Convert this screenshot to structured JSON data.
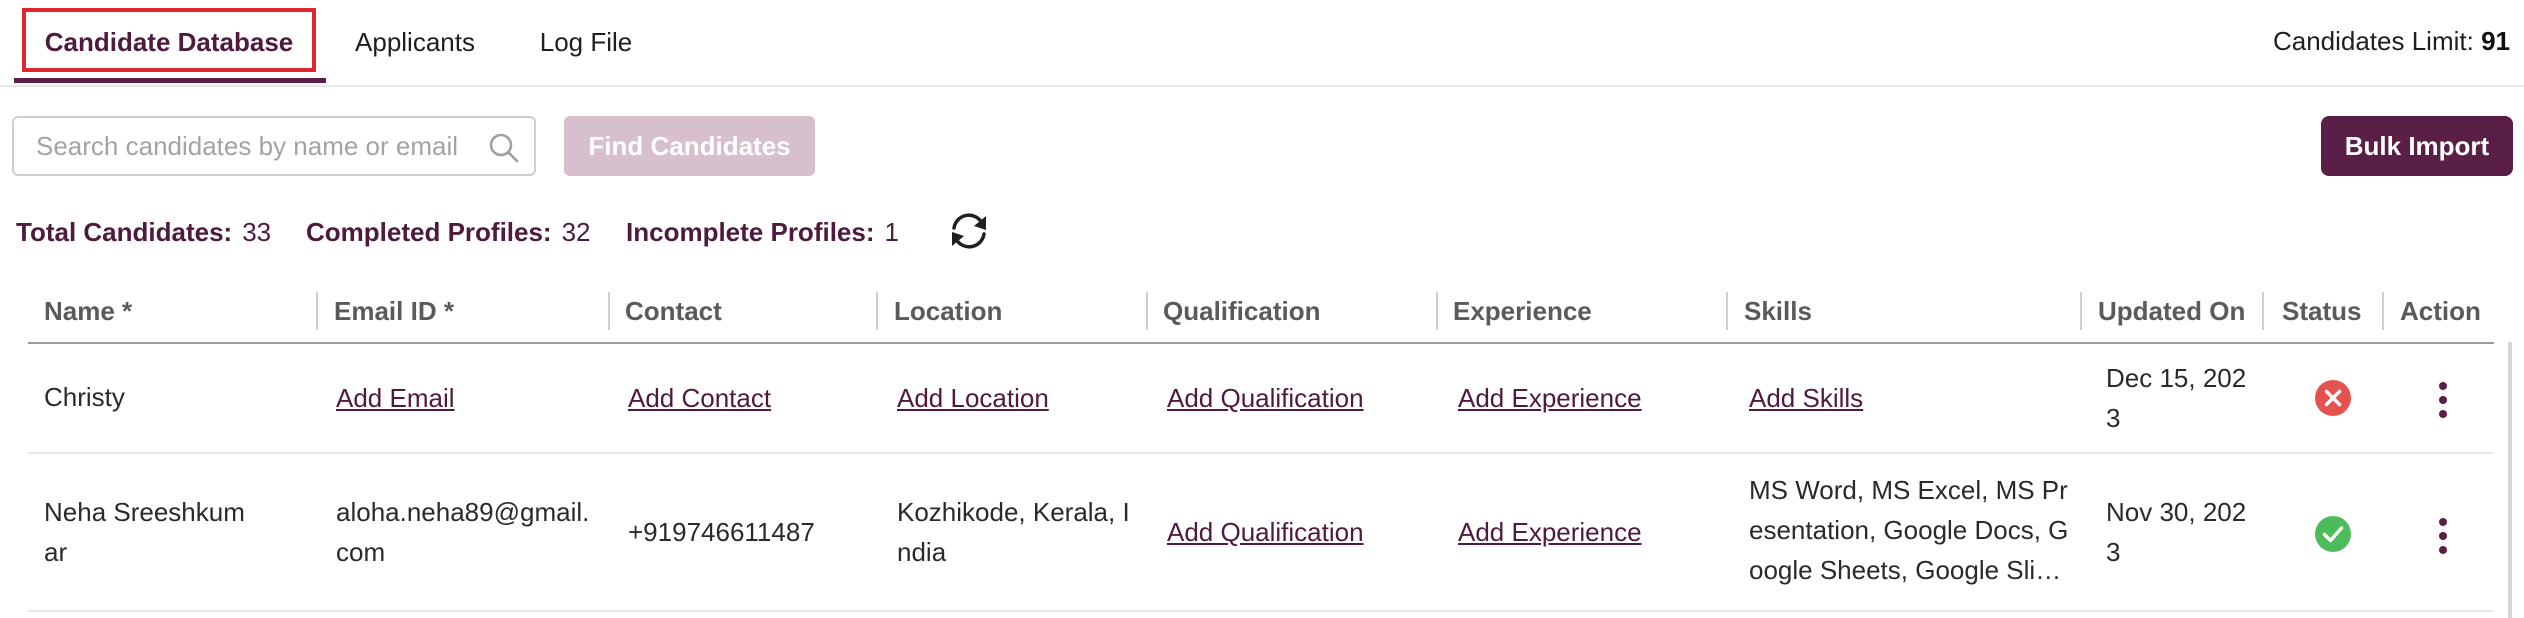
{
  "tabs": [
    {
      "label": "Candidate Database",
      "active": true
    },
    {
      "label": "Applicants",
      "active": false
    },
    {
      "label": "Log File",
      "active": false
    }
  ],
  "candidates_limit": {
    "label": "Candidates Limit:",
    "value": "91"
  },
  "search": {
    "placeholder": "Search candidates by name or email",
    "value": "",
    "icon": "search-icon"
  },
  "find_button": {
    "label": "Find Candidates"
  },
  "bulk_import_button": {
    "label": "Bulk Import"
  },
  "stats": {
    "total_label": "Total Candidates:",
    "total": "33",
    "completed_label": "Completed Profiles:",
    "completed": "32",
    "incomplete_label": "Incomplete Profiles:",
    "incomplete": "1",
    "refresh_icon": "refresh-icon"
  },
  "table": {
    "columns": [
      "Name *",
      "Email ID *",
      "Contact",
      "Location",
      "Qualification",
      "Experience",
      "Skills",
      "Updated On",
      "Status",
      "Action"
    ],
    "rows": [
      {
        "name": [
          "Christy"
        ],
        "email": {
          "link": "Add Email"
        },
        "contact": {
          "link": "Add Contact"
        },
        "location": {
          "link": "Add Location"
        },
        "qualification": {
          "link": "Add Qualification"
        },
        "experience": {
          "link": "Add Experience"
        },
        "skills": {
          "link": "Add Skills"
        },
        "updated_on": [
          "Dec 15, 202",
          "3"
        ],
        "status": "incomplete",
        "action_icon": "kebab-menu-icon"
      },
      {
        "name": [
          "Neha Sreeshkum",
          "ar"
        ],
        "email": {
          "text": [
            "aloha.neha89@gmail.",
            "com"
          ]
        },
        "contact": {
          "text": [
            "+919746611487"
          ]
        },
        "location": {
          "text": [
            "Kozhikode, Kerala, I",
            "ndia"
          ]
        },
        "qualification": {
          "link": "Add Qualification"
        },
        "experience": {
          "link": "Add Experience"
        },
        "skills": {
          "text": [
            "MS Word, MS Excel, MS Pr",
            "esentation, Google Docs, G",
            "oogle Sheets, Google Sli…"
          ]
        },
        "updated_on": [
          "Nov 30, 202",
          "3"
        ],
        "status": "complete",
        "action_icon": "kebab-menu-icon"
      }
    ]
  },
  "colors": {
    "brand": "#5a1f47",
    "brand_light": "#d7bfcd",
    "status_complete": "#4cbb5a",
    "status_incomplete": "#e4524f",
    "tab_highlight": "#e0262e"
  }
}
